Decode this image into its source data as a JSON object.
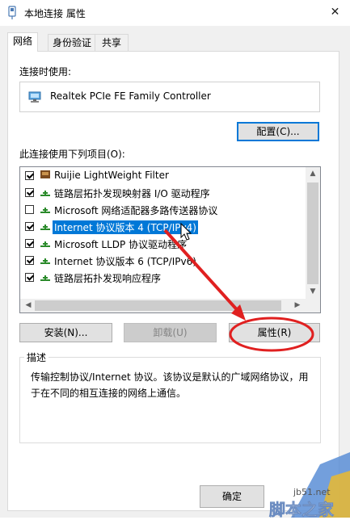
{
  "window": {
    "title": "本地连接 属性",
    "close_symbol": "✕"
  },
  "tabs": [
    {
      "label": "网络",
      "active": true
    },
    {
      "label": "身份验证",
      "active": false
    },
    {
      "label": "共享",
      "active": false
    }
  ],
  "connect_using": {
    "label": "连接时使用:",
    "adapter": "Realtek PCIe FE Family Controller"
  },
  "configure_button": "配置(C)...",
  "items_label": "此连接使用下列项目(O):",
  "items": [
    {
      "label": "Ruijie LightWeight Filter",
      "checked": true,
      "icon": "filter-icon"
    },
    {
      "label": "链路层拓扑发现映射器 I/O 驱动程序",
      "checked": true,
      "icon": "network-protocol-icon"
    },
    {
      "label": "Microsoft 网络适配器多路传送器协议",
      "checked": false,
      "icon": "network-protocol-icon"
    },
    {
      "label": "Internet 协议版本 4 (TCP/IPv4)",
      "checked": true,
      "icon": "network-protocol-icon",
      "selected": true
    },
    {
      "label": "Microsoft LLDP 协议驱动程序",
      "checked": true,
      "icon": "network-protocol-icon"
    },
    {
      "label": "Internet 协议版本 6 (TCP/IPv6)",
      "checked": true,
      "icon": "network-protocol-icon"
    },
    {
      "label": "链路层拓扑发现响应程序",
      "checked": true,
      "icon": "network-protocol-icon"
    }
  ],
  "buttons": {
    "install": "安装(N)...",
    "uninstall": "卸载(U)",
    "properties": "属性(R)",
    "ok": "确定"
  },
  "description": {
    "title": "描述",
    "text": "传输控制协议/Internet 协议。该协议是默认的广域网络协议，用于在不同的相互连接的网络上通信。"
  },
  "watermark": {
    "site": "jb51.net",
    "name": "脚本之家"
  },
  "colors": {
    "selection": "#0078d7",
    "annotation": "#e02020"
  }
}
